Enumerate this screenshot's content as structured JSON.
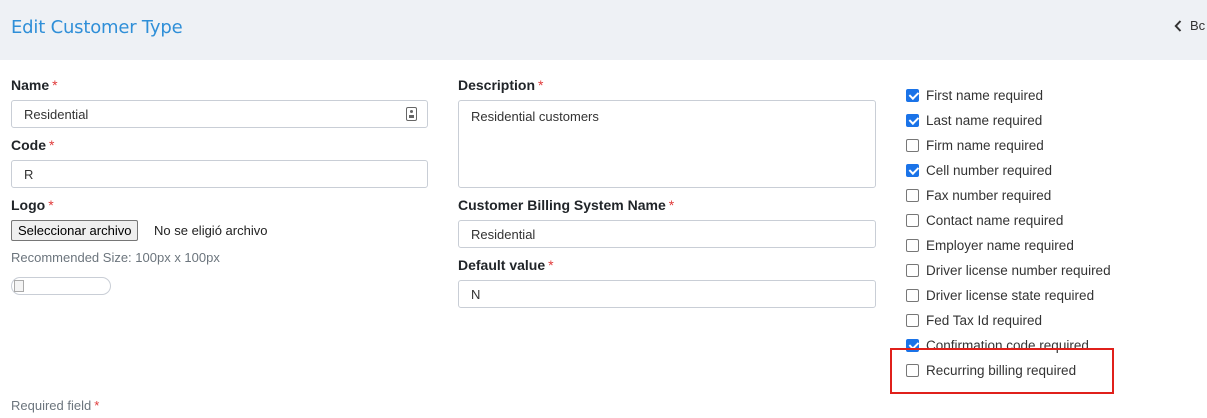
{
  "header": {
    "title": "Edit Customer Type",
    "back_label": "Bc"
  },
  "form": {
    "name": {
      "label": "Name",
      "required_mark": "*",
      "value": "Residential"
    },
    "code": {
      "label": "Code",
      "required_mark": "*",
      "value": "R"
    },
    "logo": {
      "label": "Logo",
      "required_mark": "*",
      "button_label": "Seleccionar archivo",
      "file_status": "No se eligió archivo",
      "hint": "Recommended Size: 100px x 100px"
    },
    "description": {
      "label": "Description",
      "required_mark": "*",
      "value": "Residential customers"
    },
    "billing_name": {
      "label": "Customer Billing System Name",
      "required_mark": "*",
      "value": "Residential"
    },
    "default_value": {
      "label": "Default value",
      "required_mark": "*",
      "value": "N"
    },
    "required_note": {
      "text": "Required field",
      "mark": "*"
    }
  },
  "checkboxes": [
    {
      "label": "First name required",
      "checked": true
    },
    {
      "label": "Last name required",
      "checked": true
    },
    {
      "label": "Firm name required",
      "checked": false
    },
    {
      "label": "Cell number required",
      "checked": true
    },
    {
      "label": "Fax number required",
      "checked": false
    },
    {
      "label": "Contact name required",
      "checked": false
    },
    {
      "label": "Employer name required",
      "checked": false
    },
    {
      "label": "Driver license number required",
      "checked": false
    },
    {
      "label": "Driver license state required",
      "checked": false
    },
    {
      "label": "Fed Tax Id required",
      "checked": false
    },
    {
      "label": "Confirmation code required",
      "checked": true
    },
    {
      "label": "Recurring billing required",
      "checked": false
    }
  ],
  "colors": {
    "accent": "#2f8fd8",
    "checkbox_checked": "#1a73e8",
    "required": "#e03a3a",
    "highlight": "#e0201b"
  }
}
